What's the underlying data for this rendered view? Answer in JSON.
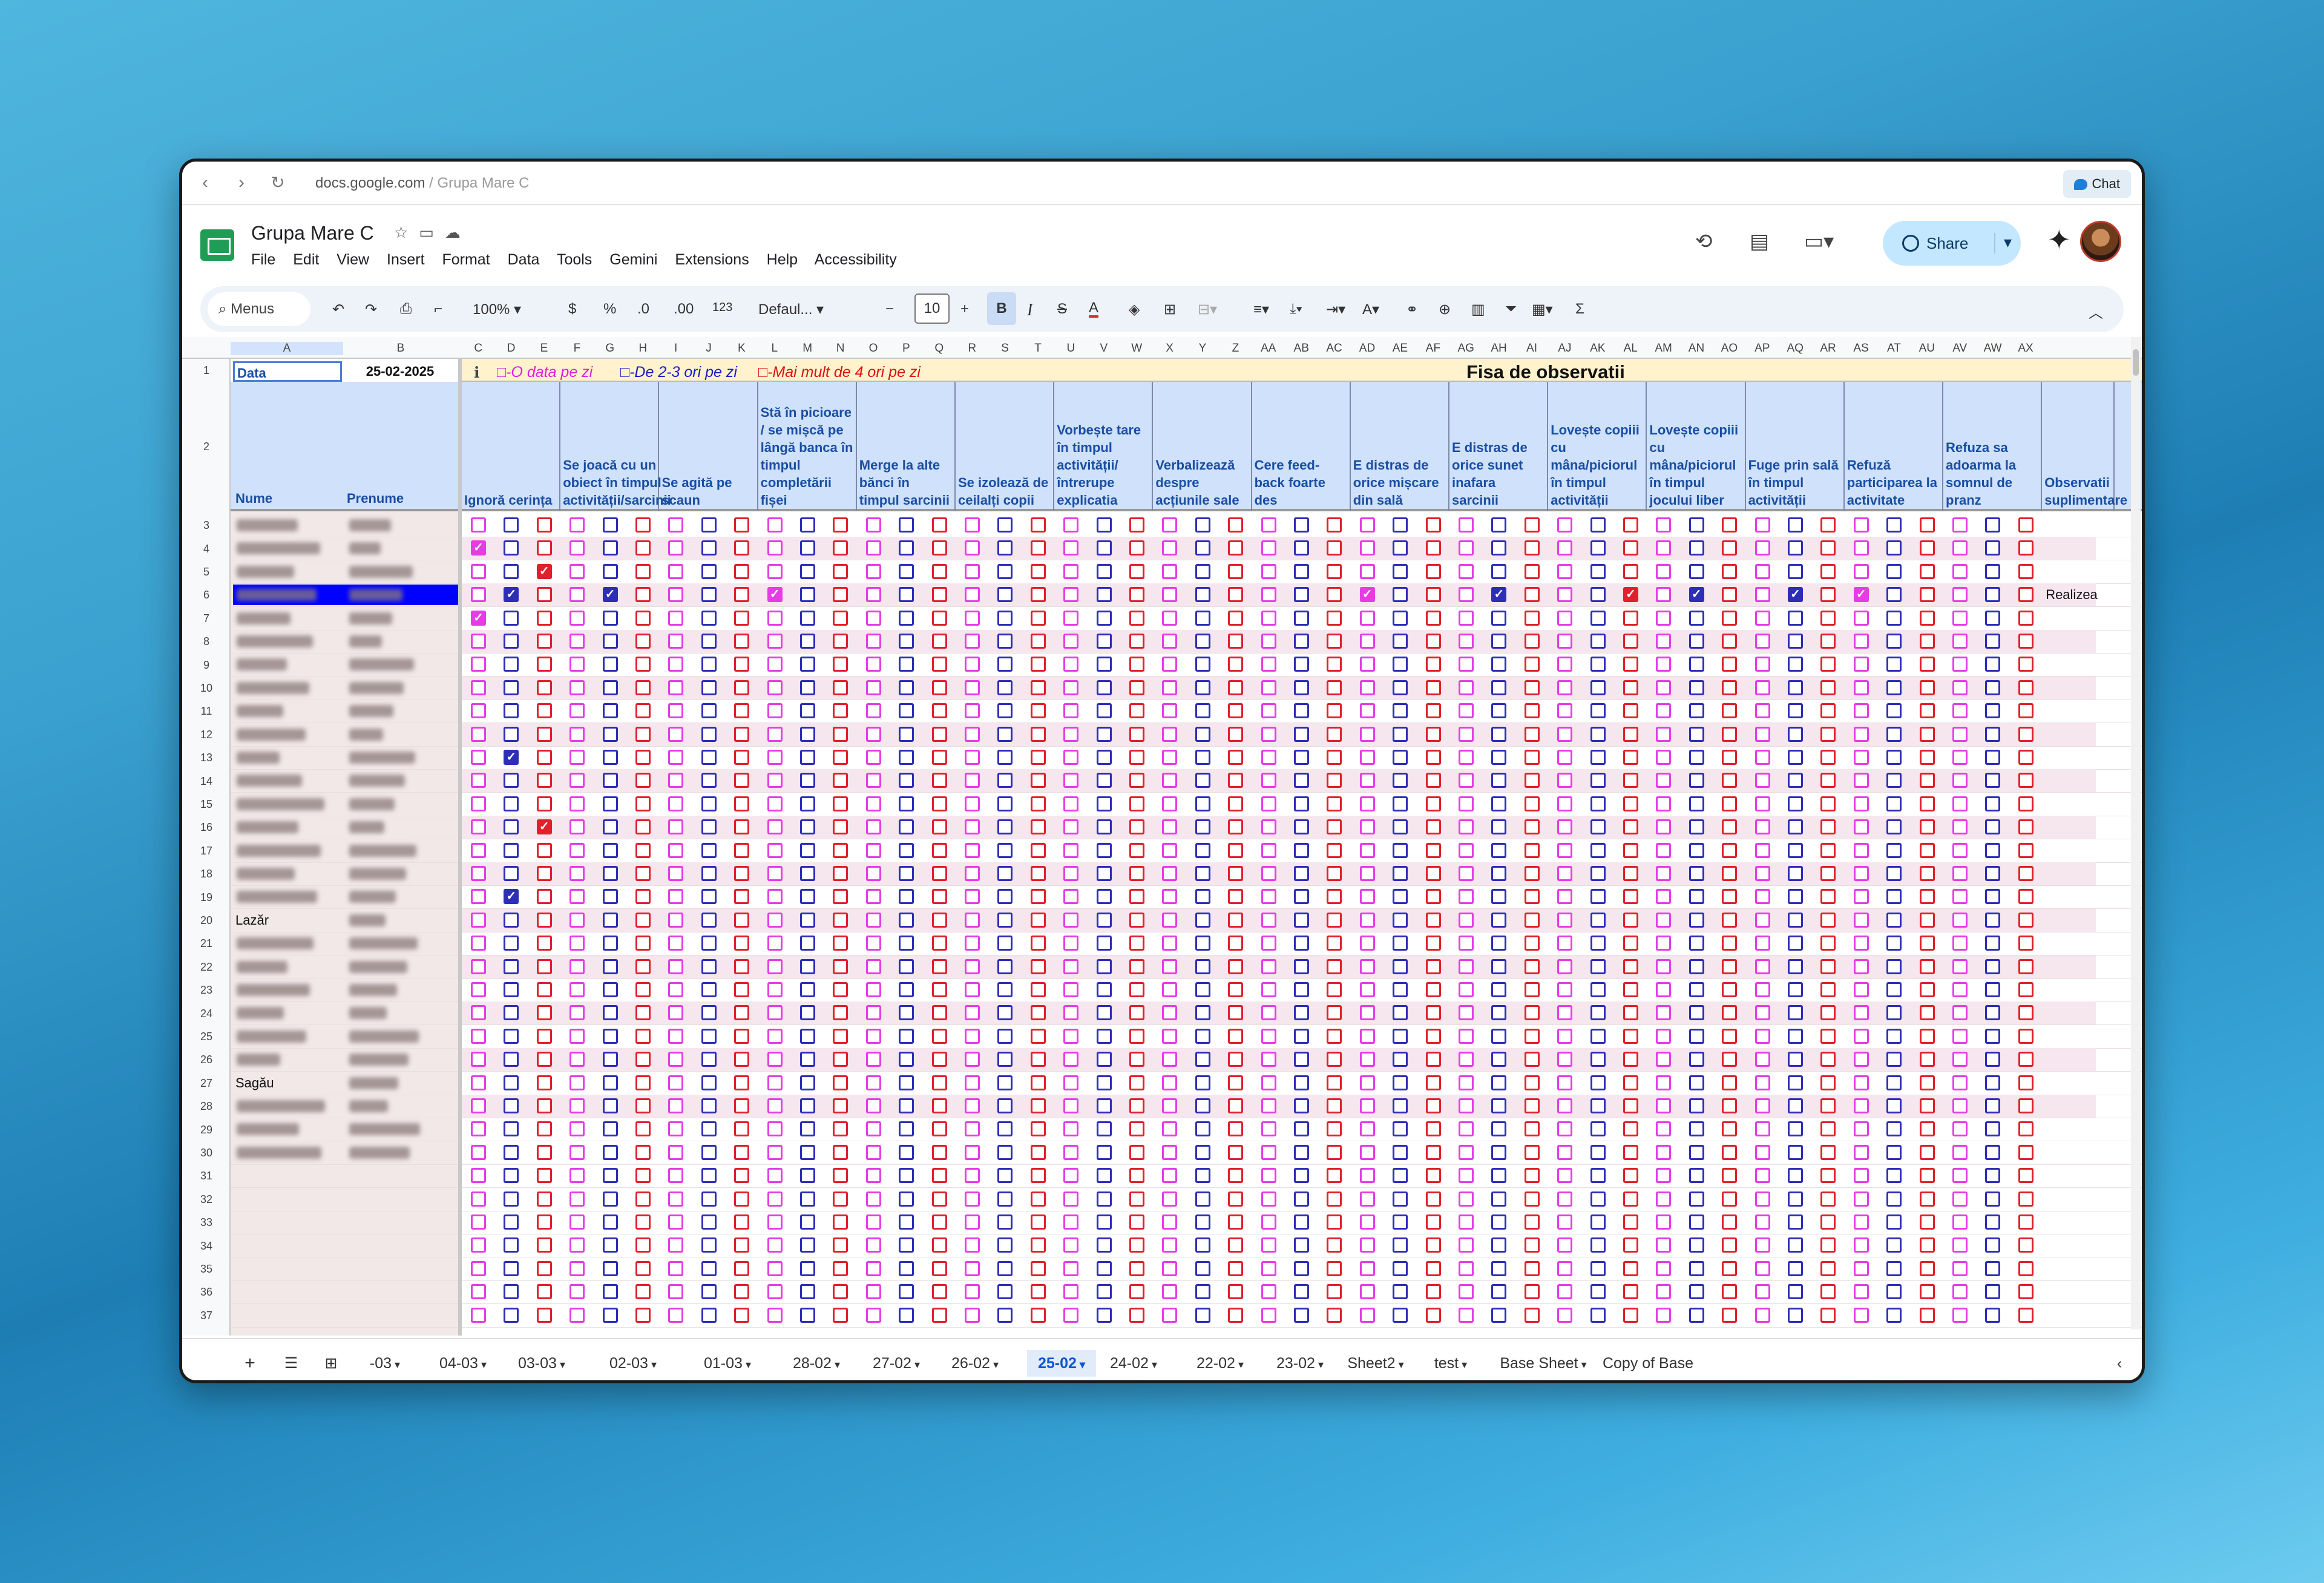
{
  "browser": {
    "url_host": "docs.google.com",
    "url_path": " / Grupa Mare C",
    "chat_label": "Chat"
  },
  "doc": {
    "title": "Grupa Mare C",
    "menus": [
      "File",
      "Edit",
      "View",
      "Insert",
      "Format",
      "Data",
      "Tools",
      "Gemini",
      "Extensions",
      "Help",
      "Accessibility"
    ],
    "share_label": "Share"
  },
  "toolbar": {
    "menus": "Menus",
    "zoom": "100%",
    "currency": "$",
    "percent": "%",
    "dec_less": ".0",
    "dec_more": ".00",
    "number_format": "123",
    "font": "Defaul...",
    "font_size": "10",
    "bold": "B",
    "italic": "I",
    "strike": "S",
    "textcolor": "A",
    "sum": "Σ"
  },
  "columns": [
    "A",
    "B",
    "C",
    "D",
    "E",
    "F",
    "G",
    "H",
    "I",
    "J",
    "K",
    "L",
    "M",
    "N",
    "O",
    "P",
    "Q",
    "R",
    "S",
    "T",
    "U",
    "V",
    "W",
    "X",
    "Y",
    "Z",
    "AA",
    "AB",
    "AC",
    "AD",
    "AE",
    "AF",
    "AG",
    "AH",
    "AI",
    "AJ",
    "AK",
    "AL",
    "AM",
    "AN",
    "AO",
    "AP",
    "AQ",
    "AR",
    "AS",
    "AT",
    "AU",
    "AV",
    "AW",
    "AX"
  ],
  "sheet": {
    "data_label": "Data",
    "date_value": "25-02-2025",
    "legend": [
      "□-O data pe zi",
      "□-De 2-3 ori pe zi",
      "□-Mai mult de 4 ori pe zi"
    ],
    "legend_colors": [
      "#e020e0",
      "#1a1ad0",
      "#e01010"
    ],
    "fisa_title": "Fisa de observatii",
    "name_header": "Nume",
    "surname_header": "Prenume",
    "headers": [
      "Ignoră cerința",
      "Se joacă cu un obiect în timpul activității/sarcinii",
      "Se agită pe scaun",
      "Stă în picioare / se mișcă pe lângă banca în timpul completării fișei",
      "Merge la alte bănci în timpul sarcinii",
      "Se izolează de ceilalți copii",
      "Vorbește tare în timpul activității/întrerupe explicatia",
      "Verbalizează despre acțiunile sale",
      "Cere feed-back foarte des",
      "E distras de orice mișcare din sală",
      "E distras de orice sunet inafara sarcinii",
      "Lovește copiii cu mâna/piciorul în timpul activității",
      "Lovește copiii cu mâna/piciorul în timpul jocului liber",
      "Fuge prin sală în timpul activității",
      "Refuză participarea la activitate",
      "Refuza sa adoarma la somnul de pranz",
      "Observatii suplimentare"
    ],
    "visible_names": [
      {
        "row": 20,
        "name": "Lazăr"
      },
      {
        "row": 27,
        "name": "Sagău"
      }
    ],
    "note_row6": "Realizea",
    "rows": [
      1,
      2,
      3,
      4,
      5,
      6,
      7,
      8,
      9,
      10,
      11,
      12,
      13,
      14,
      15,
      16,
      17,
      18,
      19,
      20,
      21,
      22,
      23,
      24,
      25,
      26,
      27,
      28,
      29,
      30,
      31,
      32,
      33,
      34,
      35,
      36,
      37
    ],
    "checked": [
      {
        "row": 4,
        "group": 0,
        "color": "p"
      },
      {
        "row": 5,
        "group": 0,
        "color": "r"
      },
      {
        "row": 6,
        "group": 0,
        "color": "b"
      },
      {
        "row": 6,
        "group": 1,
        "color": "b"
      },
      {
        "row": 6,
        "group": 3,
        "color": "p"
      },
      {
        "row": 6,
        "group": 9,
        "color": "p"
      },
      {
        "row": 6,
        "group": 10,
        "color": "b"
      },
      {
        "row": 6,
        "group": 11,
        "color": "r"
      },
      {
        "row": 6,
        "group": 12,
        "color": "b"
      },
      {
        "row": 6,
        "group": 13,
        "color": "b"
      },
      {
        "row": 6,
        "group": 14,
        "color": "p"
      },
      {
        "row": 7,
        "group": 0,
        "color": "p"
      },
      {
        "row": 13,
        "group": 0,
        "color": "b"
      },
      {
        "row": 16,
        "group": 0,
        "color": "r"
      },
      {
        "row": 19,
        "group": 0,
        "color": "b"
      }
    ]
  },
  "tabs": [
    {
      "label": "-03",
      "underline": false,
      "active": false
    },
    {
      "label": "04-03",
      "underline": false,
      "active": false
    },
    {
      "label": "03-03",
      "underline": false,
      "active": false
    },
    {
      "label": "02-03",
      "underline": true,
      "active": false
    },
    {
      "label": "01-03",
      "underline": true,
      "active": false
    },
    {
      "label": "28-02",
      "underline": false,
      "active": false
    },
    {
      "label": "27-02",
      "underline": false,
      "active": false
    },
    {
      "label": "26-02",
      "underline": false,
      "active": false
    },
    {
      "label": "25-02",
      "underline": false,
      "active": true
    },
    {
      "label": "24-02",
      "underline": false,
      "active": false
    },
    {
      "label": "22-02",
      "underline": true,
      "active": false
    },
    {
      "label": "23-02",
      "underline": true,
      "active": false
    },
    {
      "label": "Sheet2",
      "underline": false,
      "active": false
    },
    {
      "label": "test",
      "underline": false,
      "active": false
    },
    {
      "label": "Base Sheet",
      "underline": false,
      "active": false
    },
    {
      "label": "Copy of Base Sh",
      "underline": false,
      "active": false
    }
  ],
  "colors": {
    "accent": "#0b57d0",
    "pink": "#e63ce6",
    "blue": "#2d2db8",
    "red": "#e0202a",
    "header_bg": "#cfe1fb",
    "banner_bg": "#fff2cc"
  }
}
